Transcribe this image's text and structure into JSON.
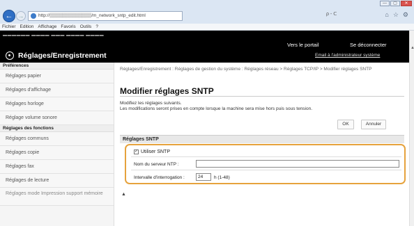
{
  "browser": {
    "address": "http://▒▒▒▒▒▒▒▒▒▒▒▒▒/m_network_sntp_edit.html",
    "address_controls": "ρ - ᑕ",
    "window_buttons": [
      "—",
      "▢",
      "✕"
    ],
    "menu": [
      "Fichier",
      "Edition",
      "Affichage",
      "Favoris",
      "Outils",
      "?"
    ]
  },
  "header": {
    "device_strip": "▬▬▬▬▬▬  ▬▬▬▬ ▬▬▬  ▬▬▬▬ ▬▬▬▬",
    "portal_link": "Vers le portail",
    "logout_link": "Se déconnecter",
    "brand": "Réglages/Enregistrement",
    "email_link": "Email à l'administrateur système"
  },
  "sidebar": {
    "group1": "Préférences",
    "group1_items": [
      "Réglages papier",
      "Réglages d'affichage",
      "Réglages horloge",
      "Réglage volume sonore"
    ],
    "group2": "Réglages des fonctions",
    "group2_items": [
      "Réglages communs",
      "Réglages copie",
      "Réglages fax",
      "Réglages de lecture",
      "Réglages mode Impression support mémoire"
    ]
  },
  "main": {
    "breadcrumb": "Réglages/Enregistrement : Réglages de gestion du système : Réglages réseau > Réglages TCP/IP > Modifier réglages SNTP",
    "title": "Modifier réglages SNTP",
    "info_line1": "Modifiez les réglages suivants.",
    "info_line2": "Les modifications seront prises en compte lorsque la machine sera mise hors puis sous tension.",
    "ok_label": "OK",
    "cancel_label": "Annuler",
    "section_title": "Réglages SNTP",
    "use_sntp_label": "Utiliser SNTP",
    "use_sntp_checked": true,
    "ntp_label": "Nom du serveur NTP :",
    "ntp_value": "",
    "interval_label": "Intervalle d'interrogation :",
    "interval_value": "24",
    "interval_unit": "h (1-48)",
    "top_link": "▲"
  }
}
